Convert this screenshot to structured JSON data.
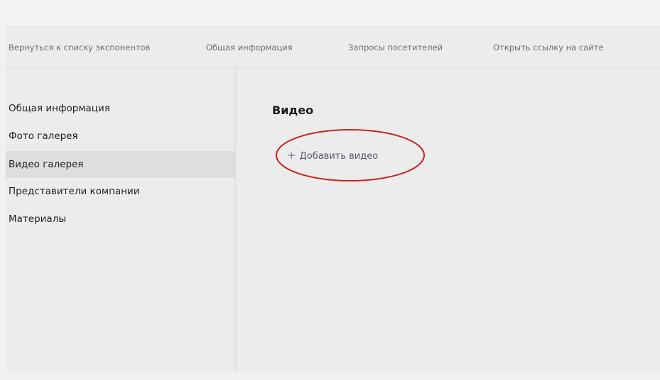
{
  "topnav": {
    "back_link": "Вернуться к списку экспонентов",
    "general_info": "Общая информация",
    "visitor_requests": "Запросы посетителей",
    "open_link": "Открыть ссылку на сайте"
  },
  "sidebar": {
    "items": [
      {
        "label": "Общая информация"
      },
      {
        "label": "Фото галерея"
      },
      {
        "label": "Видео галерея",
        "active": true
      },
      {
        "label": "Представители компании"
      },
      {
        "label": "Материалы"
      }
    ]
  },
  "main": {
    "title": "Видео",
    "add_video_label": "Добавить видео",
    "add_icon": "plus-icon"
  },
  "colors": {
    "highlight_ring": "#c4271f",
    "active_item_bg": "#dedede",
    "background": "#ececec"
  }
}
